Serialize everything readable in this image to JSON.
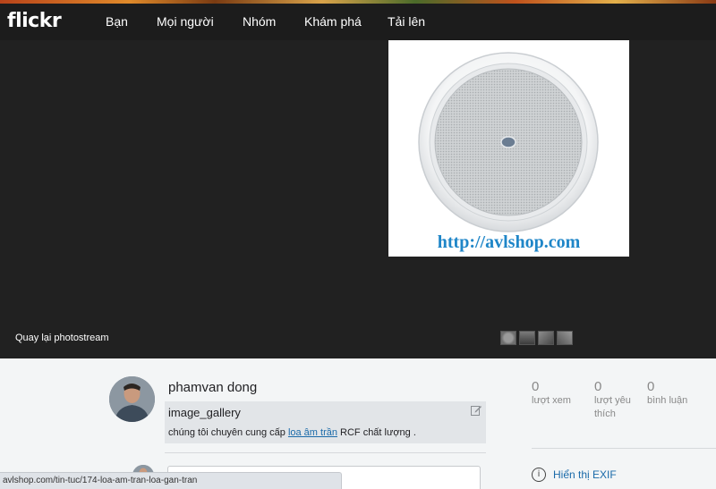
{
  "topbar": {
    "logo": "flickr",
    "nav": [
      "Bạn",
      "Mọi người",
      "Nhóm",
      "Khám phá",
      "Tải lên"
    ]
  },
  "stage": {
    "back_label": "Quay lại photostream",
    "photo_watermark": "http://avlshop.com"
  },
  "owner": {
    "name": "phamvan dong"
  },
  "description": {
    "title": "image_gallery",
    "text_before": "chúng tôi chuyên cung cấp ",
    "link": "loa âm trần",
    "text_after": " RCF chất lượng ."
  },
  "stats": [
    {
      "value": "0",
      "label_line1": "lượt xem",
      "label_line2": ""
    },
    {
      "value": "0",
      "label_line1": "lượt yêu",
      "label_line2": "thích"
    },
    {
      "value": "0",
      "label_line1": "bình luận",
      "label_line2": ""
    }
  ],
  "exif": {
    "label": "Hiển thị EXIF",
    "icon": "info-icon"
  },
  "statusbar": {
    "url": "avlshop.com/tin-tuc/174-loa-am-tran-loa-gan-tran"
  },
  "colors": {
    "topbar_bg": "#1c1c1c",
    "stage_bg": "#212121",
    "link": "#1a6aa9",
    "watermark": "#1f86c8"
  }
}
